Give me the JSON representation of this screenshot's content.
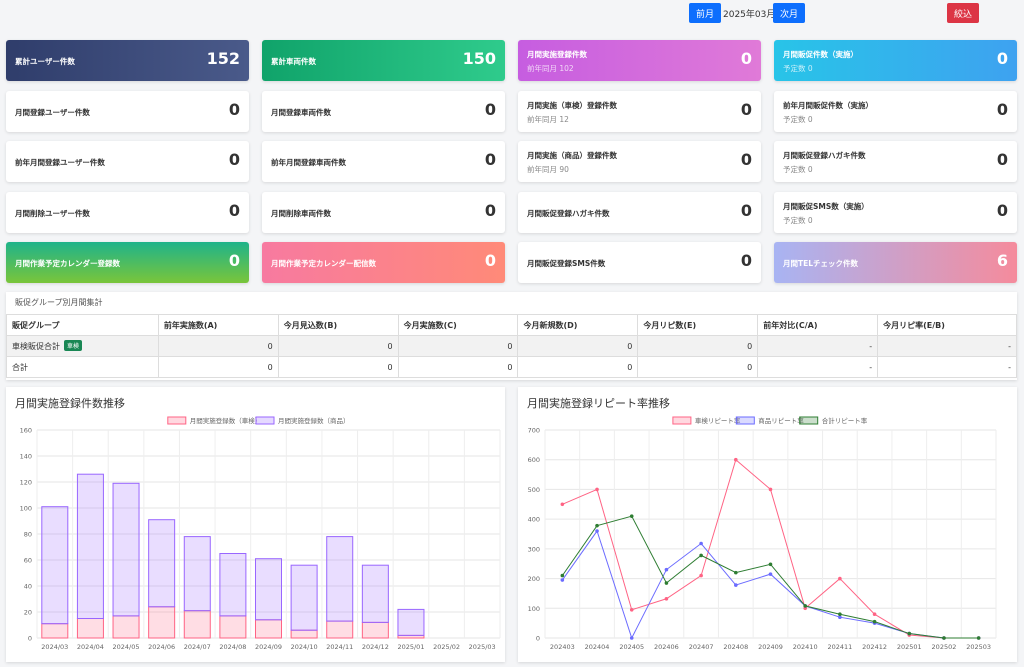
{
  "header": {
    "prev_label": "前月",
    "month_label": "2025年03月",
    "next_label": "次月",
    "filter_label": "絞込"
  },
  "cards": [
    {
      "label": "累計ユーザー件数",
      "value": "152",
      "style": "g1"
    },
    {
      "label": "累計車両件数",
      "value": "150",
      "style": "g2"
    },
    {
      "label": "月間実施登録件数",
      "sub": "前年同月 102",
      "value": "0",
      "style": "g3"
    },
    {
      "label": "月間販促件数（実施）",
      "sub": "予定数 0",
      "value": "0",
      "style": "g4"
    },
    {
      "label": "月間登録ユーザー件数",
      "value": "0"
    },
    {
      "label": "月間登録車両件数",
      "value": "0"
    },
    {
      "label": "月間実施（車検）登録件数",
      "sub": "前年同月 12",
      "value": "0"
    },
    {
      "label": "前年月間販促件数（実施）",
      "sub": "予定数 0",
      "value": "0"
    },
    {
      "label": "前年月間登録ユーザー件数",
      "value": "0"
    },
    {
      "label": "前年月間登録車両件数",
      "value": "0"
    },
    {
      "label": "月間実施（商品）登録件数",
      "sub": "前年同月 90",
      "value": "0"
    },
    {
      "label": "月間販促登録ハガキ件数",
      "sub": "予定数 0",
      "value": "0"
    },
    {
      "label": "月間削除ユーザー件数",
      "value": "0"
    },
    {
      "label": "月間削除車両件数",
      "value": "0"
    },
    {
      "label": "月間販促登録ハガキ件数",
      "value": "0"
    },
    {
      "label": "月間販促SMS数（実施）",
      "sub": "予定数 0",
      "value": "0"
    },
    {
      "label": "月間作業予定カレンダー登録数",
      "value": "0",
      "style": "g5"
    },
    {
      "label": "月間作業予定カレンダー配信数",
      "value": "0",
      "style": "g6"
    },
    {
      "label": "月間販促登録SMS件数",
      "value": "0"
    },
    {
      "label": "月間TELチェック件数",
      "value": "6",
      "style": "g7"
    }
  ],
  "group_table": {
    "title": "販促グループ別月間集計",
    "headers": [
      "販促グループ",
      "前年実施数(A)",
      "今月見込数(B)",
      "今月実施数(C)",
      "今月新規数(D)",
      "今月リピ数(E)",
      "前年対比(C/A)",
      "今月リピ率(E/B)"
    ],
    "rows": [
      {
        "name": "車検販促合計",
        "badge": "車検",
        "cells": [
          "0",
          "0",
          "0",
          "0",
          "0",
          "-",
          "-"
        ]
      },
      {
        "name": "合計",
        "cells": [
          "0",
          "0",
          "0",
          "0",
          "0",
          "-",
          "-"
        ]
      }
    ]
  },
  "charts": {
    "bar_title": "月間実施登録件数推移",
    "line_title": "月間実施登録リピート率推移"
  },
  "chart_data": [
    {
      "type": "bar",
      "title": "月間実施登録件数推移",
      "stacked": true,
      "categories": [
        "2024/03",
        "2024/04",
        "2024/05",
        "2024/06",
        "2024/07",
        "2024/08",
        "2024/09",
        "2024/10",
        "2024/11",
        "2024/12",
        "2025/01",
        "2025/02",
        "2025/03"
      ],
      "series": [
        {
          "name": "月間実施登録数（車検）",
          "color": "#ff6384",
          "values": [
            11,
            15,
            17,
            24,
            21,
            17,
            14,
            6,
            13,
            12,
            2,
            0,
            0
          ]
        },
        {
          "name": "月間実施登録数（商品）",
          "color": "#9966ff",
          "values": [
            90,
            111,
            102,
            67,
            57,
            48,
            47,
            50,
            65,
            44,
            20,
            0,
            0
          ]
        }
      ],
      "ylim": [
        0,
        160
      ],
      "yticks": [
        0,
        20,
        40,
        60,
        80,
        100,
        120,
        140,
        160
      ],
      "legend": "top"
    },
    {
      "type": "line",
      "title": "月間実施登録リピート率推移",
      "categories": [
        "202403",
        "202404",
        "202405",
        "202406",
        "202407",
        "202408",
        "202409",
        "202410",
        "202411",
        "202412",
        "202501",
        "202502",
        "202503"
      ],
      "series": [
        {
          "name": "車検リピート率",
          "color": "#ff6384",
          "values": [
            450,
            500,
            95,
            132,
            210,
            600,
            500,
            100,
            200,
            80,
            10,
            0,
            0
          ]
        },
        {
          "name": "商品リピート率",
          "color": "#6b6bff",
          "values": [
            195,
            360,
            0,
            230,
            318,
            178,
            215,
            108,
            70,
            50,
            15,
            0,
            0
          ]
        },
        {
          "name": "合計リピート率",
          "color": "#2e7d32",
          "values": [
            210,
            378,
            410,
            185,
            278,
            220,
            248,
            108,
            80,
            55,
            15,
            0,
            0
          ]
        }
      ],
      "ylim": [
        0,
        700
      ],
      "yticks": [
        0,
        100,
        200,
        300,
        400,
        500,
        600,
        700
      ],
      "legend": "top"
    }
  ]
}
